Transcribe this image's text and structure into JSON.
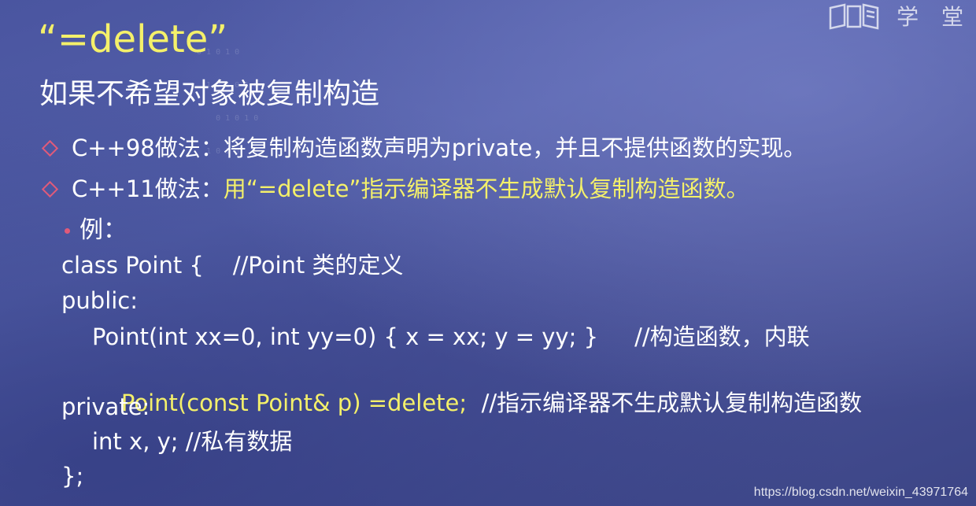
{
  "logo": {
    "icon": "book-logo-icon",
    "text": "学 堂"
  },
  "decor": {
    "binary_lines": [
      "0 1 0 1 0",
      "  1 0 1 0 1 0",
      "    0 1 0 1 0",
      "  1 0 1 0"
    ]
  },
  "slide": {
    "title": "“=delete”",
    "subtitle": "如果不希望对象被复制构造",
    "bullets": [
      {
        "prefix": "C++98做法：",
        "text": "将复制构造函数声明为private，并且不提供函数的实现。"
      },
      {
        "prefix": "C++11做法：",
        "text": "用“=delete”指示编译器不生成默认复制构造函数。"
      }
    ],
    "example_label": "例：",
    "code": {
      "line1": "class Point {    //Point 类的定义",
      "line2": "public:",
      "line3": "Point(int xx=0, int yy=0) { x = xx; y = yy; }     //构造函数，内联",
      "line4_code": "Point(const Point& p) =delete;",
      "line4_comment": "  //指示编译器不生成默认复制构造函数",
      "line5": "private:",
      "line6": "int x, y; //私有数据",
      "line7": "};"
    }
  },
  "watermark": "https://blog.csdn.net/weixin_43971764",
  "colors": {
    "highlight": "#f4f06a",
    "bullet_marker": "#e05a7a",
    "background": "#4a55a0"
  }
}
